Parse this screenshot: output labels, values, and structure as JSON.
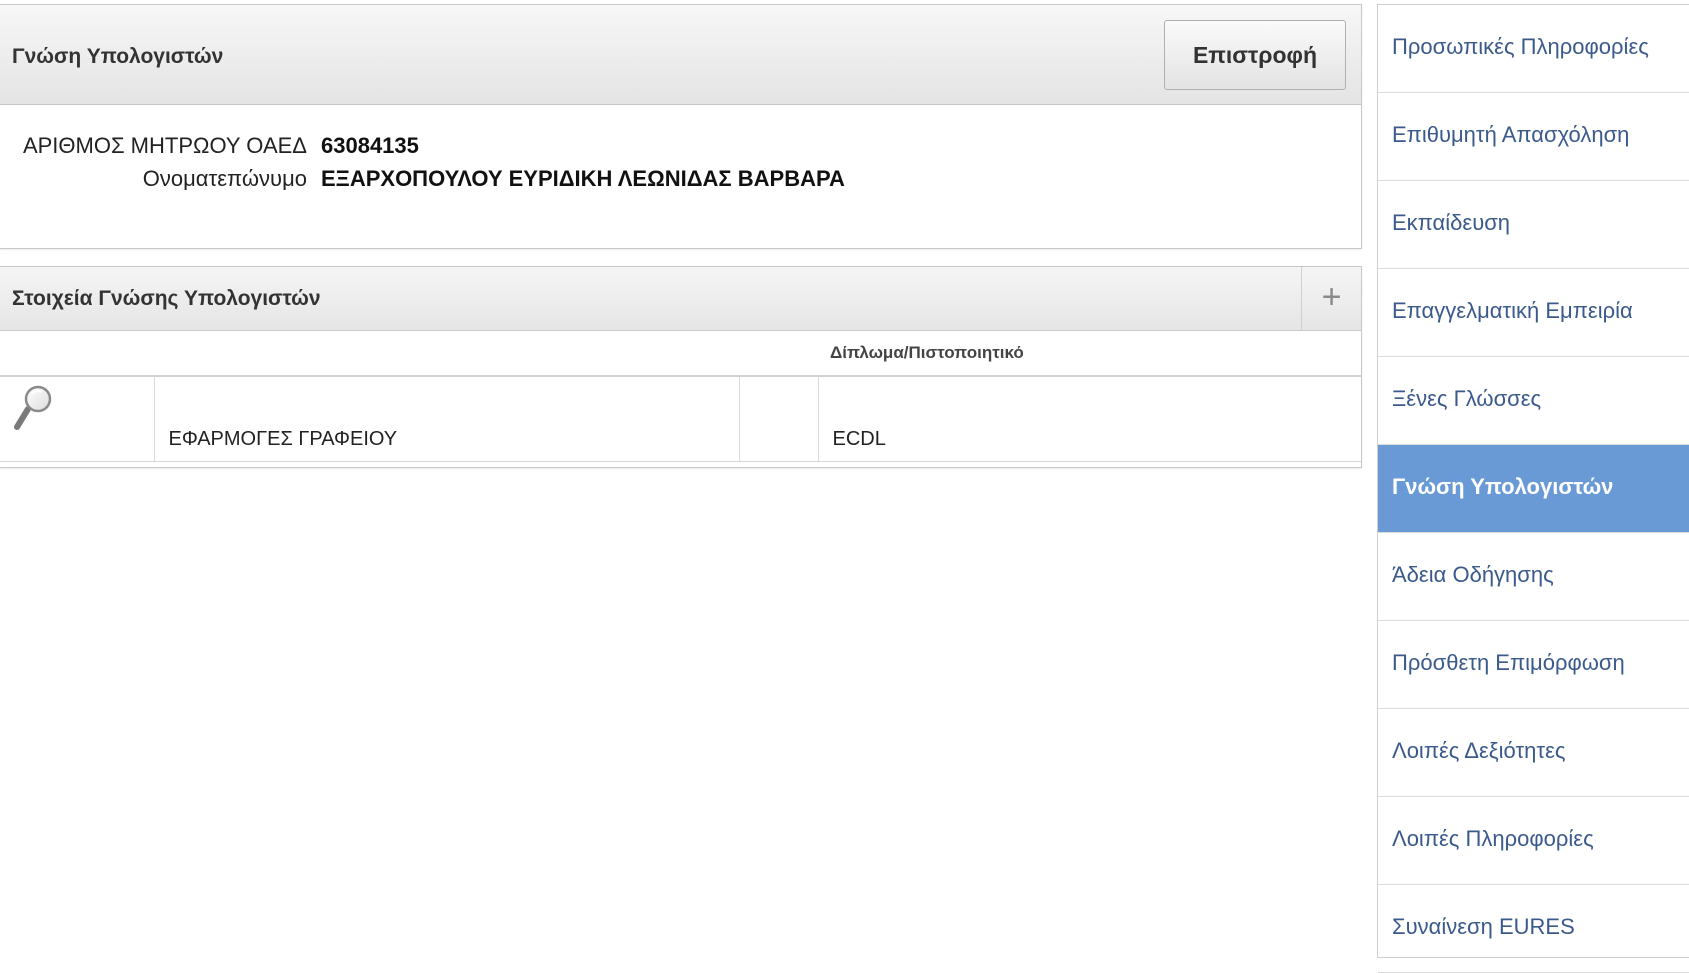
{
  "header": {
    "title": "Γνώση Υπολογιστών",
    "back_label": "Επιστροφή"
  },
  "identity": {
    "registry_label": "ΑΡΙΘΜΟΣ ΜΗΤΡΩΟΥ ΟΑΕΔ",
    "registry_value": "63084135",
    "name_label": "Ονοματεπώνυμο",
    "name_value": "ΕΞΑΡΧΟΠΟΥΛΟΥ ΕΥΡΙΔΙΚΗ ΛΕΩΝΙΔΑΣ ΒΑΡΒΑΡΑ"
  },
  "region": {
    "title": "Στοιχεία Γνώσης Υπολογιστών",
    "add_label": "+",
    "columns": [
      "",
      "",
      "",
      "Δίπλωμα/Πιστοποιητικό"
    ],
    "rows": [
      {
        "icon": "search-icon",
        "field": "ΕΦΑΡΜΟΓΕΣ ΓΡΑΦΕΙΟΥ",
        "level": "",
        "certificate": "ECDL"
      }
    ]
  },
  "sidebar": {
    "items": [
      {
        "label": "Προσωπικές Πληροφορίες",
        "active": false
      },
      {
        "label": "Επιθυμητή Απασχόληση",
        "active": false
      },
      {
        "label": "Εκπαίδευση",
        "active": false
      },
      {
        "label": "Επαγγελματική Εμπειρία",
        "active": false
      },
      {
        "label": "Ξένες Γλώσσες",
        "active": false
      },
      {
        "label": "Γνώση Υπολογιστών",
        "active": true
      },
      {
        "label": "Άδεια Οδήγησης",
        "active": false
      },
      {
        "label": "Πρόσθετη Επιμόρφωση",
        "active": false
      },
      {
        "label": "Λοιπές Δεξιότητες",
        "active": false
      },
      {
        "label": "Λοιπές Πληροφορίες",
        "active": false
      },
      {
        "label": "Συναίνεση EURES",
        "active": false
      }
    ],
    "active_color": "#6a9ad6",
    "link_color": "#3a5a8c"
  }
}
